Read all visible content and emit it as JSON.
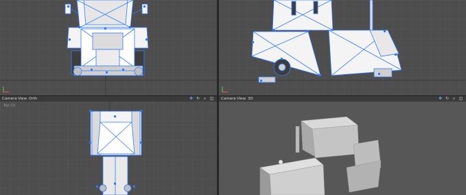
{
  "viewports": {
    "front": {
      "name": "front-viewport"
    },
    "side": {
      "name": "side-viewport"
    },
    "top": {
      "bar": {
        "camera": "Camera",
        "view": "View",
        "mode": "Orth"
      },
      "sub_label": "Top (U)"
    },
    "perspective": {
      "bar": {
        "camera": "Camera",
        "view": "View",
        "mode": "3D"
      }
    }
  },
  "toolbar_icons": [
    "move-icon",
    "rotate-icon",
    "zoom-icon",
    "maximize-icon"
  ],
  "colors": {
    "accent": "#2f7bff",
    "viewport_bg": "#4e4e4e",
    "mesh": "#f2f2f2"
  }
}
